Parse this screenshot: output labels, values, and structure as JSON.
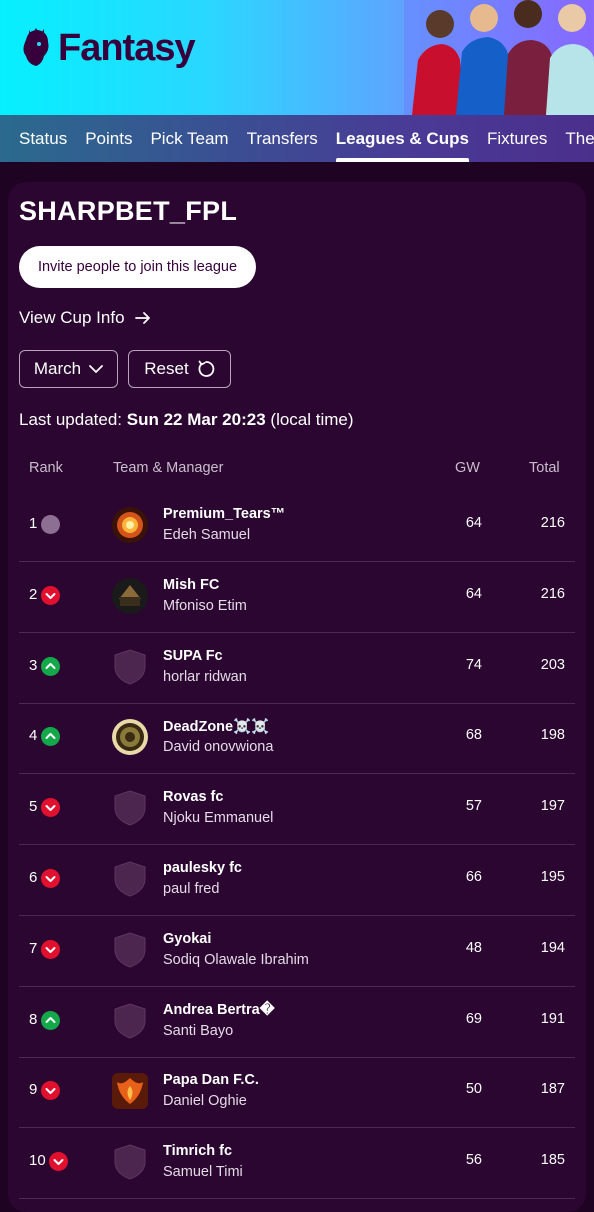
{
  "header": {
    "logo_text": "Fantasy"
  },
  "nav": [
    "Status",
    "Points",
    "Pick Team",
    "Transfers",
    "Leagues & Cups",
    "Fixtures",
    "The"
  ],
  "league": {
    "title": "SHARPBET_FPL",
    "invite_label": "Invite people to join this league",
    "cup_link": "View Cup Info",
    "month_label": "March",
    "reset_label": "Reset",
    "updated_prefix": "Last updated:",
    "updated_time": "Sun 22 Mar 20:23",
    "updated_suffix": "(local time)"
  },
  "table": {
    "headers": {
      "rank": "Rank",
      "team": "Team & Manager",
      "gw": "GW",
      "total": "Total"
    },
    "rows": [
      {
        "rank": "1",
        "movement": "same",
        "badge": "flame-crest",
        "team": "Premium_Tears™",
        "manager": "Edeh Samuel",
        "gw": "64",
        "total": "216"
      },
      {
        "rank": "2",
        "movement": "down",
        "badge": "mish-crest",
        "team": "Mish FC",
        "manager": "Mfoniso Etim",
        "gw": "64",
        "total": "216"
      },
      {
        "rank": "3",
        "movement": "up",
        "badge": "default-shield",
        "team": "SUPA Fc",
        "manager": "horlar ridwan",
        "gw": "74",
        "total": "203"
      },
      {
        "rank": "4",
        "movement": "up",
        "badge": "deadzone-crest",
        "team": "DeadZone☠️☠️",
        "manager": "David onovwiona",
        "gw": "68",
        "total": "198"
      },
      {
        "rank": "5",
        "movement": "down",
        "badge": "default-shield",
        "team": "Rovas fc",
        "manager": "Njoku Emmanuel",
        "gw": "57",
        "total": "197"
      },
      {
        "rank": "6",
        "movement": "down",
        "badge": "default-shield",
        "team": "paulesky fc",
        "manager": "paul fred",
        "gw": "66",
        "total": "195"
      },
      {
        "rank": "7",
        "movement": "down",
        "badge": "default-shield",
        "team": "Gyokai",
        "manager": "Sodiq Olawale Ibrahim",
        "gw": "48",
        "total": "194"
      },
      {
        "rank": "8",
        "movement": "up",
        "badge": "default-shield",
        "team": "Andrea Bertra�",
        "manager": "Santi Bayo",
        "gw": "69",
        "total": "191"
      },
      {
        "rank": "9",
        "movement": "down",
        "badge": "phoenix-crest",
        "team": "Papa Dan F.C.",
        "manager": "Daniel Oghie",
        "gw": "50",
        "total": "187"
      },
      {
        "rank": "10",
        "movement": "down",
        "badge": "default-shield",
        "team": "Timrich fc",
        "manager": "Samuel Timi",
        "gw": "56",
        "total": "185"
      }
    ]
  }
}
